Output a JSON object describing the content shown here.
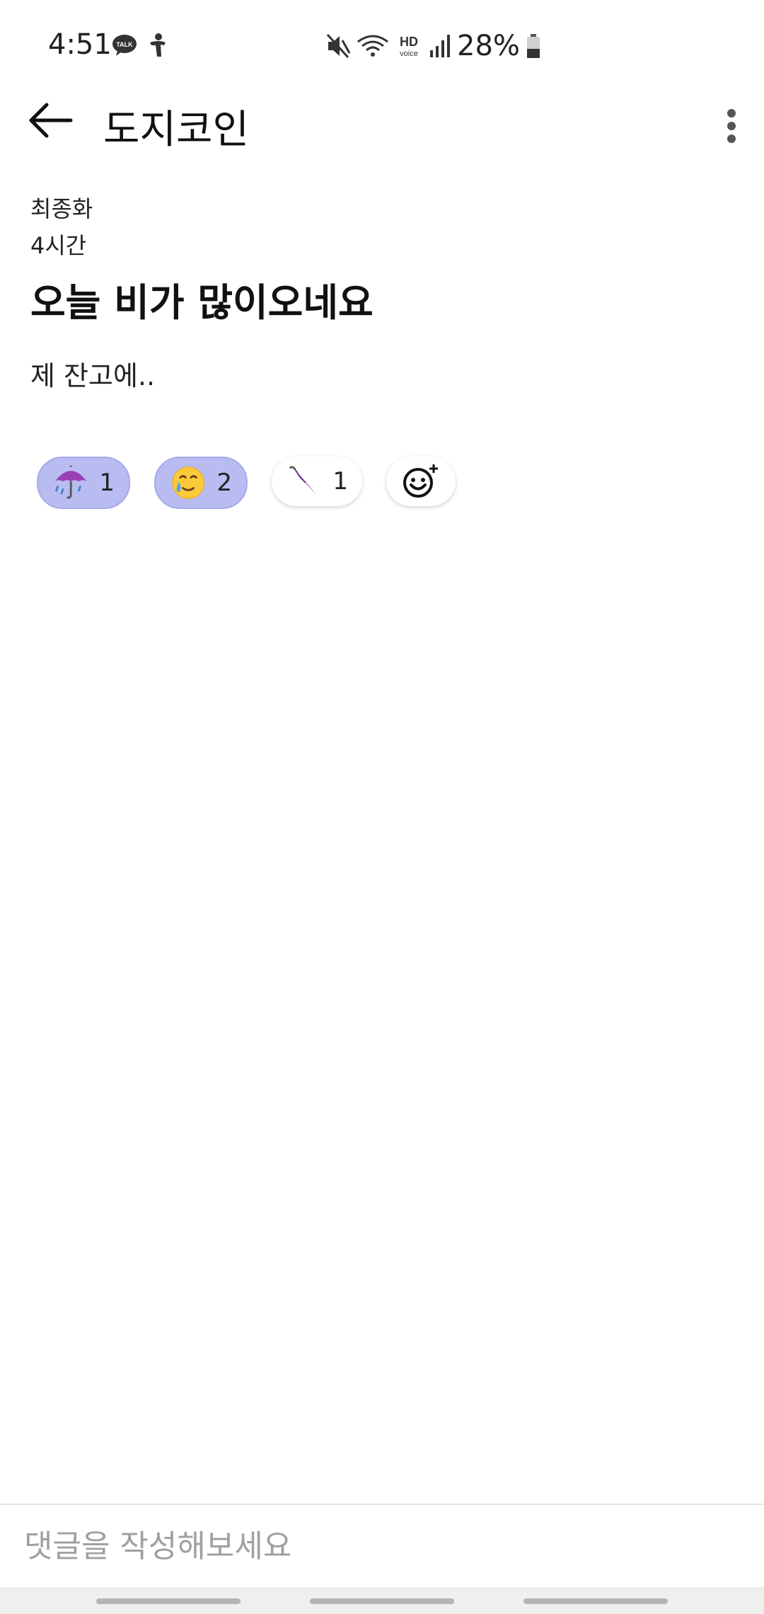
{
  "status_bar": {
    "time": "4:51",
    "battery_percent": "28%",
    "icons": [
      "kakaotalk-icon",
      "accessibility-icon",
      "mute-icon",
      "wifi-icon",
      "hd-voice-icon",
      "signal-icon",
      "battery-icon"
    ]
  },
  "header": {
    "title": "도지코인",
    "back_icon": "arrow-left-icon",
    "more_icon": "more-vertical-icon"
  },
  "post": {
    "author": "최종화",
    "time_ago": "4시간",
    "title": "오늘 비가 많이오네요",
    "body": "제 잔고에.."
  },
  "reactions": [
    {
      "icon": "umbrella-with-rain-icon",
      "count": "1",
      "selected": true
    },
    {
      "icon": "crying-smile-face-icon",
      "count": "2",
      "selected": true
    },
    {
      "icon": "closed-umbrella-icon",
      "count": "1",
      "selected": false
    }
  ],
  "add_reaction_icon": "add-emoji-icon",
  "comment": {
    "placeholder": "댓글을 작성해보세요",
    "value": ""
  },
  "colors": {
    "selected_chip": "#b9bcf1",
    "background": "#ffffff",
    "nav_bar": "#efefef"
  }
}
